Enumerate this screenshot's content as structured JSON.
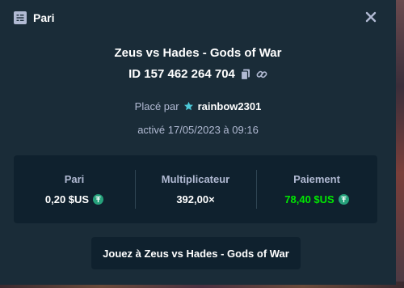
{
  "header": {
    "title": "Pari",
    "icon": "bet-slip-icon",
    "close_icon": "close-icon"
  },
  "bet": {
    "game_title": "Zeus vs Hades - Gods of War",
    "id_text": "ID 157 462 264 704",
    "placed_by_label": "Placé par",
    "username": "rainbow2301",
    "date_text": "activé 17/05/2023 à 09:16"
  },
  "stats": {
    "bet_label": "Pari",
    "bet_value": "0,20 $US",
    "multiplier_label": "Multiplicateur",
    "multiplier_value": "392,00×",
    "payout_label": "Paiement",
    "payout_value": "78,40 $US"
  },
  "play_button": "Jouez à Zeus vs Hades - Gods of War",
  "colors": {
    "background": "#1a2c38",
    "card": "#0f212e",
    "muted": "#b1bad3",
    "win": "#00e701",
    "tether": "#26a17b"
  }
}
